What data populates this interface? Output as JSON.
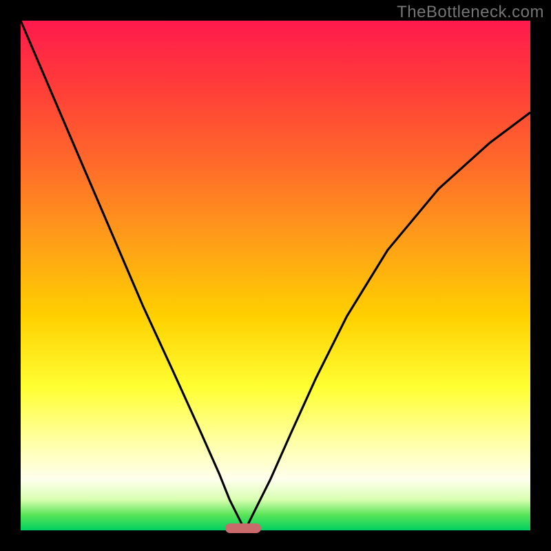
{
  "watermark": "TheBottleneck.com",
  "chart_data": {
    "type": "line",
    "title": "",
    "xlabel": "",
    "ylabel": "",
    "xlim": [
      0,
      100
    ],
    "ylim": [
      0,
      100
    ],
    "grid": false,
    "note": "Axes are unlabeled; values are normalized 0–100 estimated from pixel positions. Two curves descend from the top edge toward a common minimum near x≈44, y≈0, over a vertical heat gradient from red (top) to green (bottom).",
    "series": [
      {
        "name": "left-curve",
        "x": [
          0,
          6,
          12,
          18,
          24,
          30,
          35,
          39,
          41,
          43,
          44
        ],
        "y": [
          100,
          86,
          72,
          58,
          44,
          31,
          20,
          11,
          6,
          2,
          0
        ]
      },
      {
        "name": "right-curve",
        "x": [
          44,
          46,
          49,
          53,
          58,
          64,
          72,
          82,
          92,
          100
        ],
        "y": [
          0,
          4,
          10,
          19,
          30,
          42,
          55,
          67,
          76,
          82
        ]
      }
    ],
    "marker": {
      "name": "min-dash",
      "x_center": 44,
      "y": 0,
      "width_pct": 7,
      "color": "#c96b6b"
    },
    "background_gradient_stops": [
      {
        "pos": 0.0,
        "color": "#ff1a4d"
      },
      {
        "pos": 0.28,
        "color": "#ff6a2a"
      },
      {
        "pos": 0.58,
        "color": "#ffd000"
      },
      {
        "pos": 0.83,
        "color": "#ffffaa"
      },
      {
        "pos": 0.97,
        "color": "#58e458"
      },
      {
        "pos": 1.0,
        "color": "#00d060"
      }
    ]
  }
}
